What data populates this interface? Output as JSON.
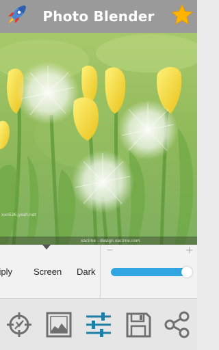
{
  "header": {
    "title": "Photo Blender",
    "logo_icon": "rocket-icon",
    "favorite_icon": "star-icon"
  },
  "photo": {
    "watermark_left": "xxn526.yeah.net",
    "watermark_right": "xacirne - design.xacirne.com"
  },
  "blend_modes": {
    "items": [
      "ltiply",
      "Screen",
      "Dark"
    ],
    "selected": "Screen"
  },
  "opacity": {
    "minus_label": "−",
    "plus_label": "+",
    "level": 0.97
  },
  "toolbar": {
    "items": [
      {
        "icon": "crosshair-icon",
        "name": "position"
      },
      {
        "icon": "image-icon",
        "name": "gallery"
      },
      {
        "icon": "sliders-icon",
        "name": "adjust"
      },
      {
        "icon": "save-icon",
        "name": "save"
      },
      {
        "icon": "share-icon",
        "name": "share"
      }
    ]
  },
  "colors": {
    "header_bg": "#9a9a9a",
    "accent": "#31a5e0",
    "icon_gray": "#6f6f6f",
    "star": "#ffb400"
  }
}
